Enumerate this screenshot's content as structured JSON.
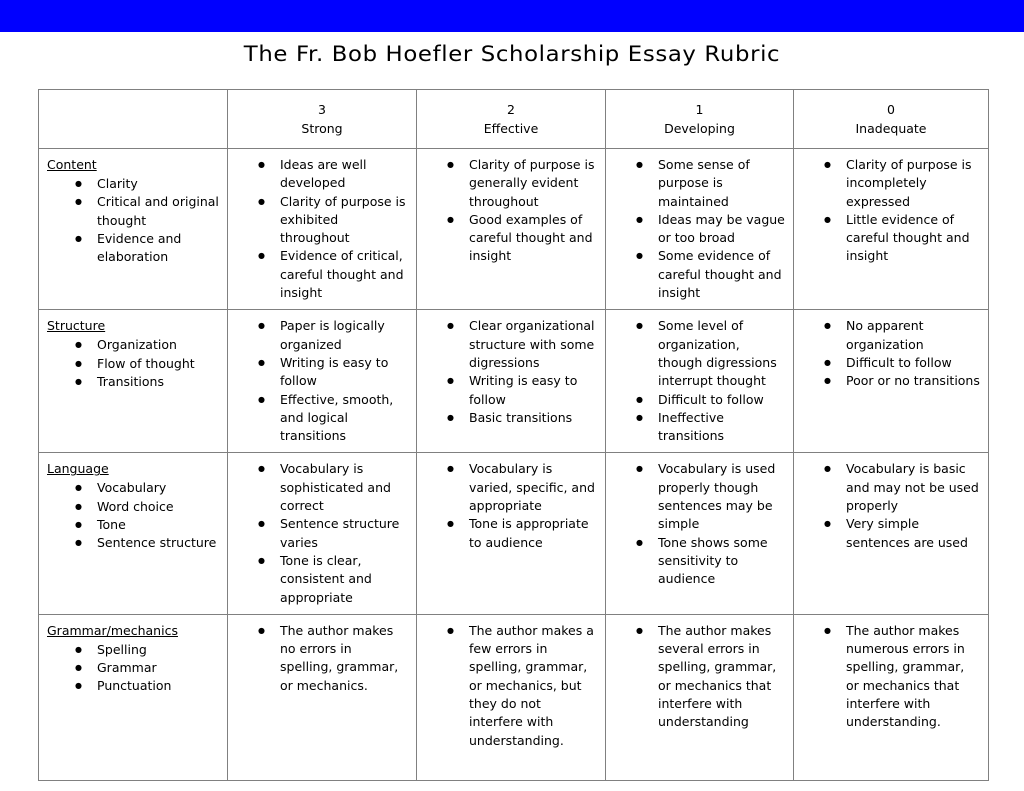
{
  "banner": {
    "color": "#0000FF"
  },
  "title": "The Fr. Bob Hoefler Scholarship Essay Rubric",
  "table": {
    "columns": [
      {
        "num": "",
        "label": ""
      },
      {
        "num": "3",
        "label": "Strong"
      },
      {
        "num": "2",
        "label": "Effective"
      },
      {
        "num": "1",
        "label": "Developing"
      },
      {
        "num": "0",
        "label": "Inadequate"
      }
    ],
    "rows": [
      {
        "criteria": "Content",
        "criteria_items": [
          "Clarity",
          "Critical and original thought",
          "Evidence and elaboration"
        ],
        "score3": [
          "Ideas are well developed",
          "Clarity of purpose is exhibited throughout",
          "Evidence of critical, careful thought and insight"
        ],
        "score2": [
          "Clarity of purpose is generally evident throughout",
          "Good examples of careful thought and insight"
        ],
        "score1": [
          "Some sense of purpose is maintained",
          "Ideas may be vague or too broad",
          "Some evidence of careful thought and insight"
        ],
        "score0": [
          "Clarity of purpose is incompletely expressed",
          "Little evidence of careful thought and insight"
        ]
      },
      {
        "criteria": "Structure",
        "criteria_items": [
          "Organization",
          "Flow of thought",
          "Transitions"
        ],
        "score3": [
          "Paper is logically organized",
          "Writing is easy to follow",
          "Effective, smooth, and logical transitions"
        ],
        "score2": [
          "Clear organizational structure with some digressions",
          "Writing is easy to follow",
          "Basic transitions"
        ],
        "score1": [
          "Some level of organization, though digressions interrupt thought",
          "Difficult to follow",
          "Ineffective transitions"
        ],
        "score0": [
          "No apparent organization",
          "Difficult to follow",
          "Poor or no transitions"
        ]
      },
      {
        "criteria": "Language",
        "criteria_items": [
          "Vocabulary",
          "Word choice",
          "Tone",
          "Sentence structure"
        ],
        "score3": [
          "Vocabulary is sophisticated and correct",
          "Sentence structure varies",
          "Tone is clear, consistent and appropriate"
        ],
        "score2": [
          "Vocabulary is varied, specific, and appropriate",
          "Tone is appropriate to audience"
        ],
        "score1": [
          "Vocabulary is used properly though sentences may be simple",
          "Tone shows some sensitivity to audience"
        ],
        "score0": [
          "Vocabulary is basic and may not be used properly",
          "Very simple sentences are used"
        ]
      },
      {
        "criteria": "Grammar/mechanics",
        "criteria_items": [
          "Spelling",
          "Grammar",
          "Punctuation"
        ],
        "score3": [
          "The author makes no errors in spelling, grammar, or mechanics."
        ],
        "score2": [
          "The author makes a few errors in spelling, grammar, or mechanics, but they do not interfere with understanding."
        ],
        "score1": [
          "The author makes several errors in spelling, grammar, or mechanics that interfere with understanding"
        ],
        "score0": [
          "The author makes numerous errors in spelling, grammar, or mechanics that interfere with understanding."
        ]
      }
    ]
  }
}
